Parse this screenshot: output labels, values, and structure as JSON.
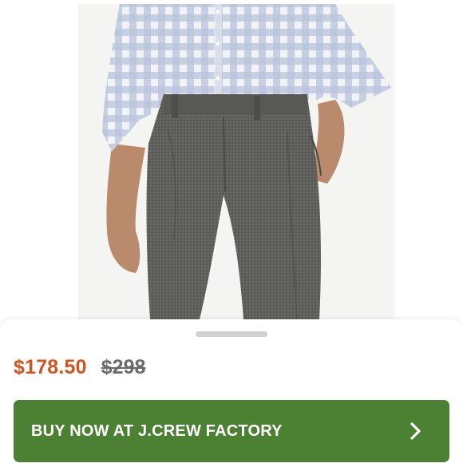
{
  "product": {
    "sale_price": "$178.50",
    "original_price": "$298",
    "image_icon": "product-photo-trousers"
  },
  "cta": {
    "label": "BUY NOW AT J.CREW FACTORY",
    "icon": "chevron-right-icon"
  },
  "colors": {
    "sale_price": "#d3541d",
    "original_price": "#6b6b6b",
    "button": "#4c8134",
    "button_text": "#ffffff"
  }
}
